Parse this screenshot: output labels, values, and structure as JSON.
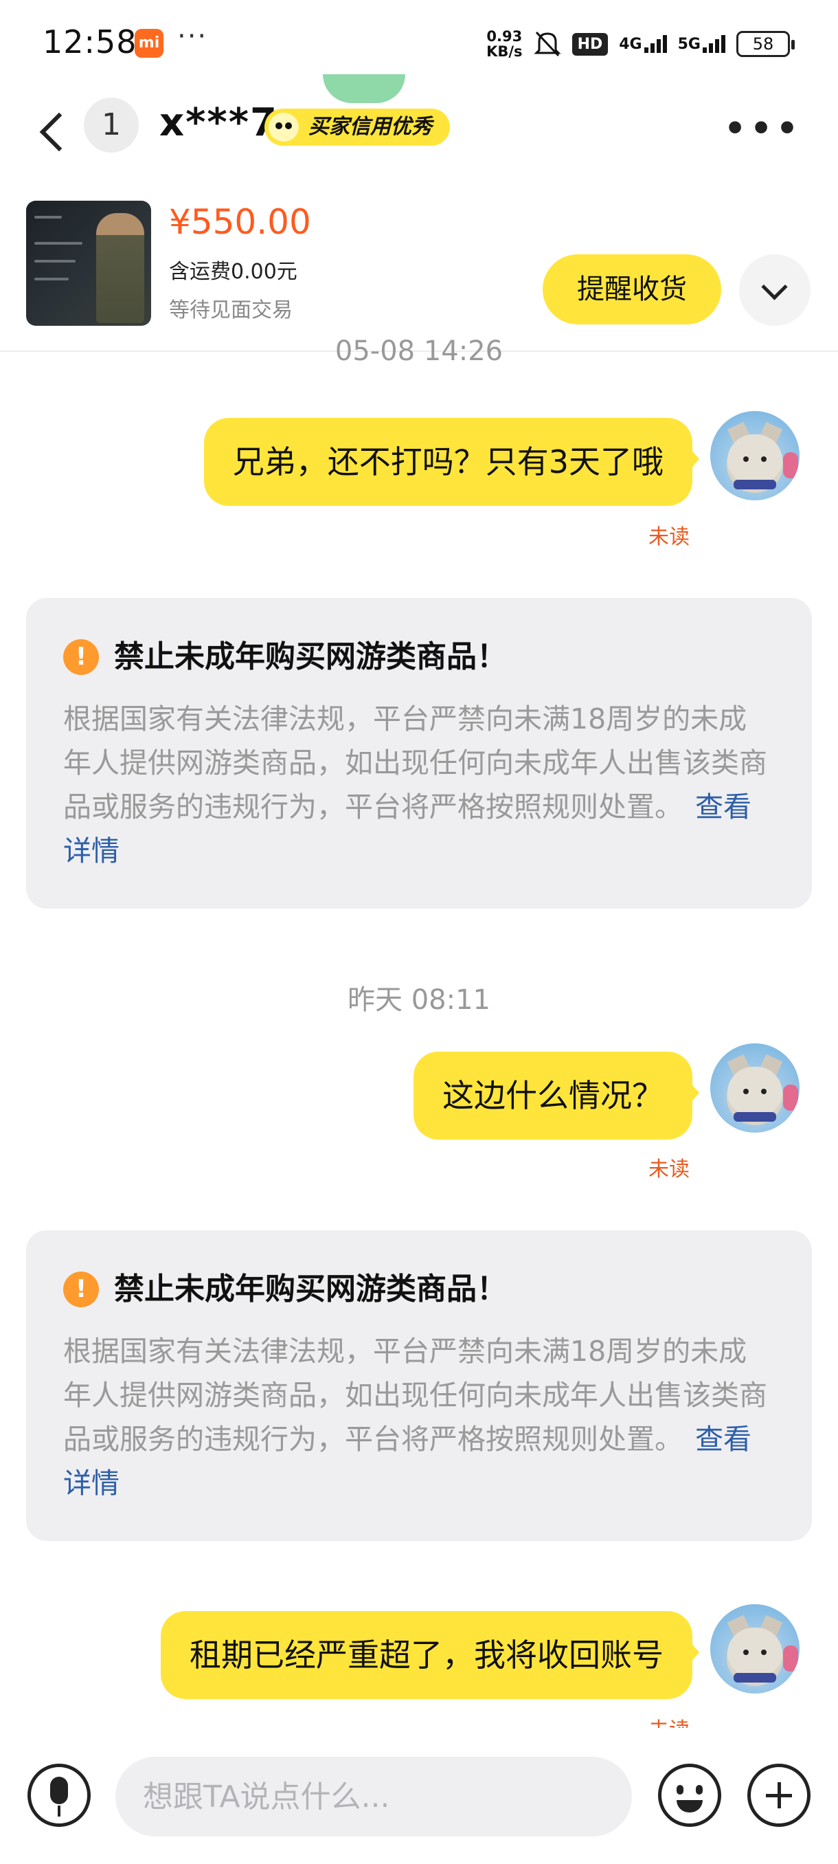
{
  "status_bar": {
    "time": "12:58",
    "mi_label": "mi",
    "dots": "···",
    "net_speed_value": "0.93",
    "net_speed_unit": "KB/s",
    "hd": "HD",
    "net_4g": "4G",
    "net_5g": "5G",
    "battery": "58"
  },
  "header": {
    "unread_count": "1",
    "buyer_name": "x***7",
    "credit_badge": "买家信用优秀",
    "more": "•••"
  },
  "product": {
    "price": "¥550.00",
    "shipping": "含运费0.00元",
    "status": "等待见面交易",
    "remind_button": "提醒收货"
  },
  "messages": [
    {
      "timestamp": "05-08 14:26",
      "text": "兄弟，还不打吗？只有3天了哦",
      "read_state": "未读"
    },
    {
      "timestamp": "昨天 08:11",
      "text": "这边什么情况？",
      "read_state": "未读"
    },
    {
      "text": "租期已经严重超了，我将收回账号",
      "read_state": "未读"
    }
  ],
  "warning": {
    "icon": "!",
    "title": "禁止未成年购买网游类商品！",
    "body": "根据国家有关法律法规，平台严禁向未满18周岁的未成年人提供网游类商品，如出现任何向未成年人出售该类商品或服务的违规行为，平台将严格按照规则处置。",
    "link": "查看详情"
  },
  "input": {
    "placeholder": "想跟TA说点什么..."
  },
  "colors": {
    "accent_yellow": "#ffe53b",
    "price_orange": "#ff5a1f",
    "unread_orange": "#e85a1f",
    "link_blue": "#2e5fa8",
    "card_gray": "#efeff2"
  }
}
